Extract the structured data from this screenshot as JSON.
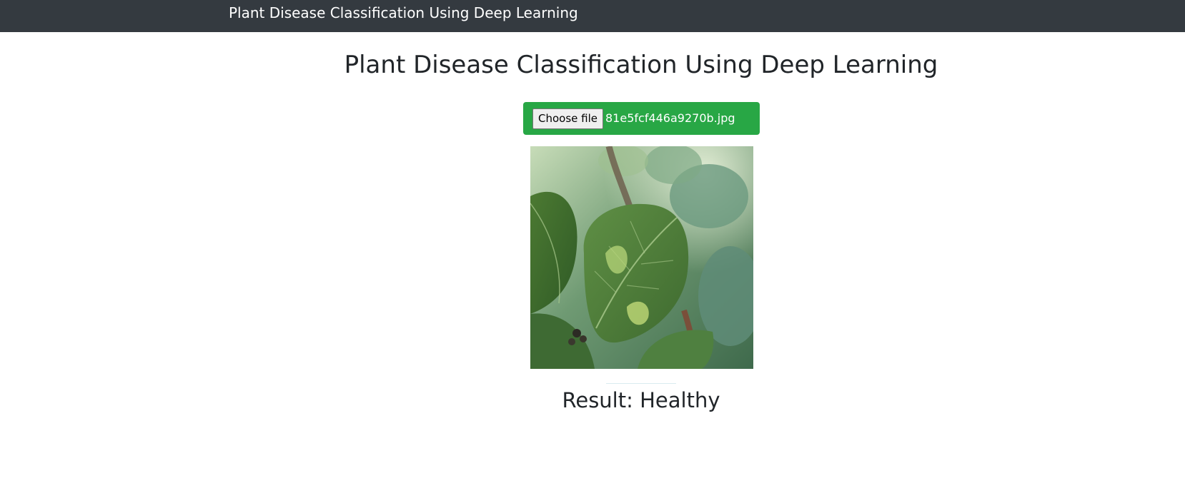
{
  "navbar": {
    "brand": "Plant Disease Classification Using Deep Learning"
  },
  "main": {
    "title": "Plant Disease Classification Using Deep Learning",
    "upload": {
      "button_label": "Choose file",
      "file_name": "81e5fcf446a9270b.jpg",
      "background_color": "#28a745"
    },
    "result_text": "Result: Healthy"
  },
  "colors": {
    "navbar": "#343a40",
    "upload_box": "#28a745"
  }
}
